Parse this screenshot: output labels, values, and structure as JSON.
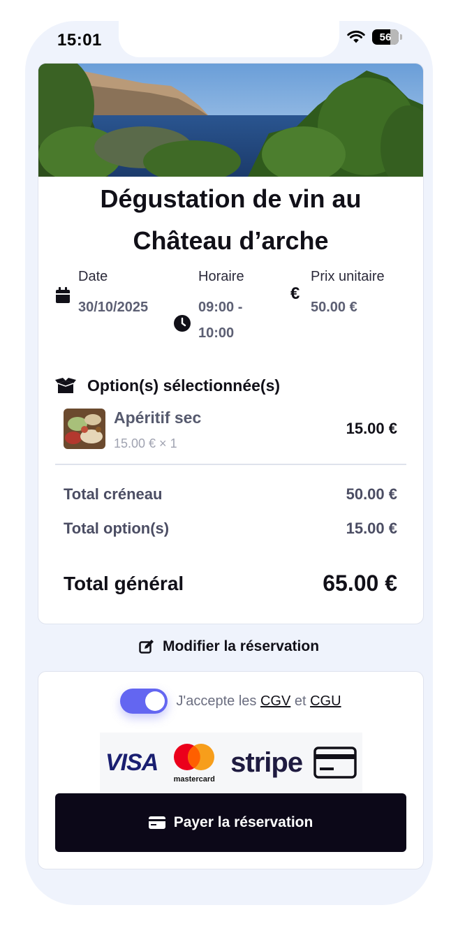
{
  "status_bar": {
    "time": "15:01",
    "battery": "56"
  },
  "activity": {
    "title_line1": "Dégustation de vin au",
    "title_line2": "Château d’arche",
    "date_label": "Date",
    "date_value": "30/10/2025",
    "time_label": "Horaire",
    "time_value_line1": "09:00 -",
    "time_value_line2": "10:00",
    "price_label": "Prix unitaire",
    "price_value": "50.00 €",
    "euro_symbol": "€"
  },
  "options": {
    "header": "Option(s) sélectionnée(s)",
    "items": [
      {
        "name": "Apéritif sec",
        "detail": "15.00 € × 1",
        "price": "15.00 €"
      }
    ]
  },
  "totals": {
    "slot_label": "Total créneau",
    "slot_value": "50.00 €",
    "options_label": "Total option(s)",
    "options_value": "15.00 €",
    "grand_label": "Total général",
    "grand_value": "65.00 €"
  },
  "modify_label": "Modifier la réservation",
  "payment": {
    "accept_prefix": "J'accepte les ",
    "cgv": "CGV",
    "and": " et ",
    "cgu": "CGU",
    "logos": {
      "visa": "VISA",
      "mastercard": "mastercard",
      "stripe": "stripe"
    },
    "pay_button": "Payer la réservation",
    "toggle_on": true,
    "accent_color": "#6366f1"
  }
}
